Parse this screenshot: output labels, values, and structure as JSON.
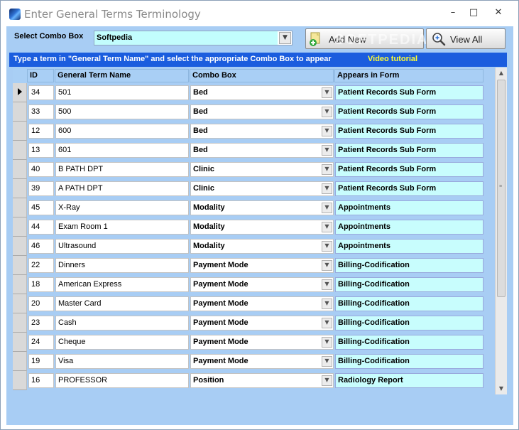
{
  "window": {
    "title": "Enter General Terms Terminology",
    "controls": {
      "minimize": "–",
      "maximize": "□",
      "close": "✕"
    }
  },
  "toolbar": {
    "combo_label": "Select Combo Box",
    "combo_value": "Softpedia",
    "add_new_label": "Add New",
    "view_all_label": "View All",
    "watermark": "SOFTPEDIA"
  },
  "info": {
    "text": "Type a term in \"General Term Name\" and select the appropriate Combo Box to appear",
    "video_link": "Video tutorial"
  },
  "grid": {
    "headers": {
      "id": "ID",
      "name": "General Term  Name",
      "combo": "Combo Box",
      "form": "Appears in Form"
    },
    "rows": [
      {
        "id": "34",
        "name": "501",
        "combo": "Bed",
        "form": "Patient Records Sub Form"
      },
      {
        "id": "33",
        "name": "500",
        "combo": "Bed",
        "form": "Patient Records Sub Form"
      },
      {
        "id": "12",
        "name": "600",
        "combo": "Bed",
        "form": "Patient Records Sub Form"
      },
      {
        "id": "13",
        "name": "601",
        "combo": "Bed",
        "form": "Patient Records Sub Form"
      },
      {
        "id": "40",
        "name": "B PATH DPT",
        "combo": "Clinic",
        "form": "Patient Records Sub Form"
      },
      {
        "id": "39",
        "name": "A PATH DPT",
        "combo": "Clinic",
        "form": "Patient Records Sub Form"
      },
      {
        "id": "45",
        "name": "X-Ray",
        "combo": "Modality",
        "form": "Appointments"
      },
      {
        "id": "44",
        "name": "Exam Room 1",
        "combo": "Modality",
        "form": "Appointments"
      },
      {
        "id": "46",
        "name": "Ultrasound",
        "combo": "Modality",
        "form": "Appointments"
      },
      {
        "id": "22",
        "name": "Dinners",
        "combo": "Payment Mode",
        "form": "Billing-Codification"
      },
      {
        "id": "18",
        "name": "American Express",
        "combo": "Payment Mode",
        "form": "Billing-Codification"
      },
      {
        "id": "20",
        "name": "Master Card",
        "combo": "Payment Mode",
        "form": "Billing-Codification"
      },
      {
        "id": "23",
        "name": "Cash",
        "combo": "Payment Mode",
        "form": "Billing-Codification"
      },
      {
        "id": "24",
        "name": "Cheque",
        "combo": "Payment Mode",
        "form": "Billing-Codification"
      },
      {
        "id": "19",
        "name": "Visa",
        "combo": "Payment Mode",
        "form": "Billing-Codification"
      },
      {
        "id": "16",
        "name": "PROFESSOR",
        "combo": "Position",
        "form": "Radiology Report"
      }
    ]
  },
  "colors": {
    "client_bg": "#a8cdf4",
    "info_bar": "#1b5dde",
    "video_link": "#ffff33",
    "form_cell": "#c8fdfd"
  },
  "icons": {
    "app": "app-globe-icon",
    "add": "add-document-icon",
    "view": "magnifier-icon"
  }
}
